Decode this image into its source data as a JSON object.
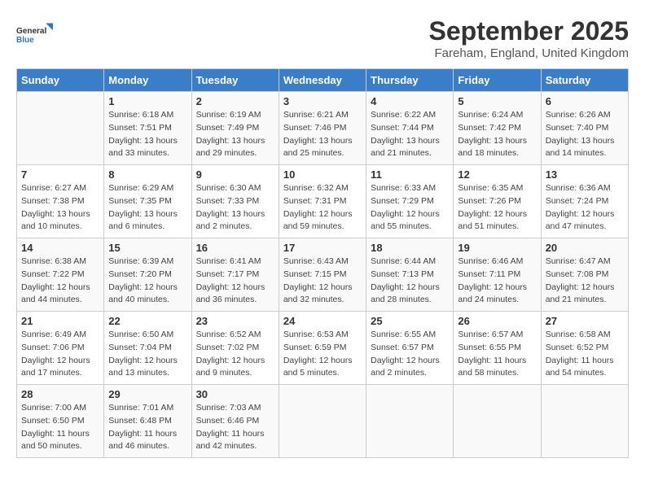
{
  "logo": {
    "text_general": "General",
    "text_blue": "Blue"
  },
  "title": "September 2025",
  "location": "Fareham, England, United Kingdom",
  "days_header": [
    "Sunday",
    "Monday",
    "Tuesday",
    "Wednesday",
    "Thursday",
    "Friday",
    "Saturday"
  ],
  "weeks": [
    [
      {
        "day": "",
        "info": ""
      },
      {
        "day": "1",
        "info": "Sunrise: 6:18 AM\nSunset: 7:51 PM\nDaylight: 13 hours\nand 33 minutes."
      },
      {
        "day": "2",
        "info": "Sunrise: 6:19 AM\nSunset: 7:49 PM\nDaylight: 13 hours\nand 29 minutes."
      },
      {
        "day": "3",
        "info": "Sunrise: 6:21 AM\nSunset: 7:46 PM\nDaylight: 13 hours\nand 25 minutes."
      },
      {
        "day": "4",
        "info": "Sunrise: 6:22 AM\nSunset: 7:44 PM\nDaylight: 13 hours\nand 21 minutes."
      },
      {
        "day": "5",
        "info": "Sunrise: 6:24 AM\nSunset: 7:42 PM\nDaylight: 13 hours\nand 18 minutes."
      },
      {
        "day": "6",
        "info": "Sunrise: 6:26 AM\nSunset: 7:40 PM\nDaylight: 13 hours\nand 14 minutes."
      }
    ],
    [
      {
        "day": "7",
        "info": "Sunrise: 6:27 AM\nSunset: 7:38 PM\nDaylight: 13 hours\nand 10 minutes."
      },
      {
        "day": "8",
        "info": "Sunrise: 6:29 AM\nSunset: 7:35 PM\nDaylight: 13 hours\nand 6 minutes."
      },
      {
        "day": "9",
        "info": "Sunrise: 6:30 AM\nSunset: 7:33 PM\nDaylight: 13 hours\nand 2 minutes."
      },
      {
        "day": "10",
        "info": "Sunrise: 6:32 AM\nSunset: 7:31 PM\nDaylight: 12 hours\nand 59 minutes."
      },
      {
        "day": "11",
        "info": "Sunrise: 6:33 AM\nSunset: 7:29 PM\nDaylight: 12 hours\nand 55 minutes."
      },
      {
        "day": "12",
        "info": "Sunrise: 6:35 AM\nSunset: 7:26 PM\nDaylight: 12 hours\nand 51 minutes."
      },
      {
        "day": "13",
        "info": "Sunrise: 6:36 AM\nSunset: 7:24 PM\nDaylight: 12 hours\nand 47 minutes."
      }
    ],
    [
      {
        "day": "14",
        "info": "Sunrise: 6:38 AM\nSunset: 7:22 PM\nDaylight: 12 hours\nand 44 minutes."
      },
      {
        "day": "15",
        "info": "Sunrise: 6:39 AM\nSunset: 7:20 PM\nDaylight: 12 hours\nand 40 minutes."
      },
      {
        "day": "16",
        "info": "Sunrise: 6:41 AM\nSunset: 7:17 PM\nDaylight: 12 hours\nand 36 minutes."
      },
      {
        "day": "17",
        "info": "Sunrise: 6:43 AM\nSunset: 7:15 PM\nDaylight: 12 hours\nand 32 minutes."
      },
      {
        "day": "18",
        "info": "Sunrise: 6:44 AM\nSunset: 7:13 PM\nDaylight: 12 hours\nand 28 minutes."
      },
      {
        "day": "19",
        "info": "Sunrise: 6:46 AM\nSunset: 7:11 PM\nDaylight: 12 hours\nand 24 minutes."
      },
      {
        "day": "20",
        "info": "Sunrise: 6:47 AM\nSunset: 7:08 PM\nDaylight: 12 hours\nand 21 minutes."
      }
    ],
    [
      {
        "day": "21",
        "info": "Sunrise: 6:49 AM\nSunset: 7:06 PM\nDaylight: 12 hours\nand 17 minutes."
      },
      {
        "day": "22",
        "info": "Sunrise: 6:50 AM\nSunset: 7:04 PM\nDaylight: 12 hours\nand 13 minutes."
      },
      {
        "day": "23",
        "info": "Sunrise: 6:52 AM\nSunset: 7:02 PM\nDaylight: 12 hours\nand 9 minutes."
      },
      {
        "day": "24",
        "info": "Sunrise: 6:53 AM\nSunset: 6:59 PM\nDaylight: 12 hours\nand 5 minutes."
      },
      {
        "day": "25",
        "info": "Sunrise: 6:55 AM\nSunset: 6:57 PM\nDaylight: 12 hours\nand 2 minutes."
      },
      {
        "day": "26",
        "info": "Sunrise: 6:57 AM\nSunset: 6:55 PM\nDaylight: 11 hours\nand 58 minutes."
      },
      {
        "day": "27",
        "info": "Sunrise: 6:58 AM\nSunset: 6:52 PM\nDaylight: 11 hours\nand 54 minutes."
      }
    ],
    [
      {
        "day": "28",
        "info": "Sunrise: 7:00 AM\nSunset: 6:50 PM\nDaylight: 11 hours\nand 50 minutes."
      },
      {
        "day": "29",
        "info": "Sunrise: 7:01 AM\nSunset: 6:48 PM\nDaylight: 11 hours\nand 46 minutes."
      },
      {
        "day": "30",
        "info": "Sunrise: 7:03 AM\nSunset: 6:46 PM\nDaylight: 11 hours\nand 42 minutes."
      },
      {
        "day": "",
        "info": ""
      },
      {
        "day": "",
        "info": ""
      },
      {
        "day": "",
        "info": ""
      },
      {
        "day": "",
        "info": ""
      }
    ]
  ]
}
